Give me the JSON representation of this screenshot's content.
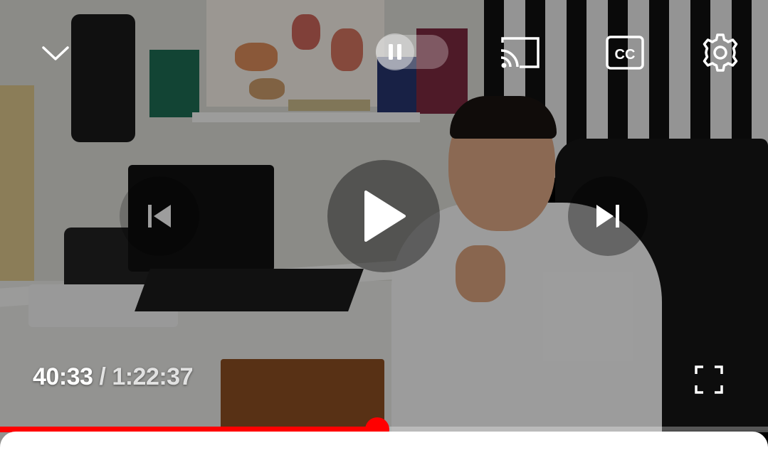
{
  "player": {
    "current_time": "40:33",
    "separator": " / ",
    "duration": "1:22:37",
    "progress_fraction": 0.491,
    "accent_color": "#ff0000",
    "captions_label": "CC",
    "state": "paused"
  },
  "icons": {
    "minimize": "chevron-down-icon",
    "autoplay_toggle": "pause-icon",
    "cast": "cast-icon",
    "captions": "cc-icon",
    "settings": "gear-icon",
    "previous": "skip-previous-icon",
    "play": "play-icon",
    "next": "skip-next-icon",
    "fullscreen": "fullscreen-icon"
  }
}
